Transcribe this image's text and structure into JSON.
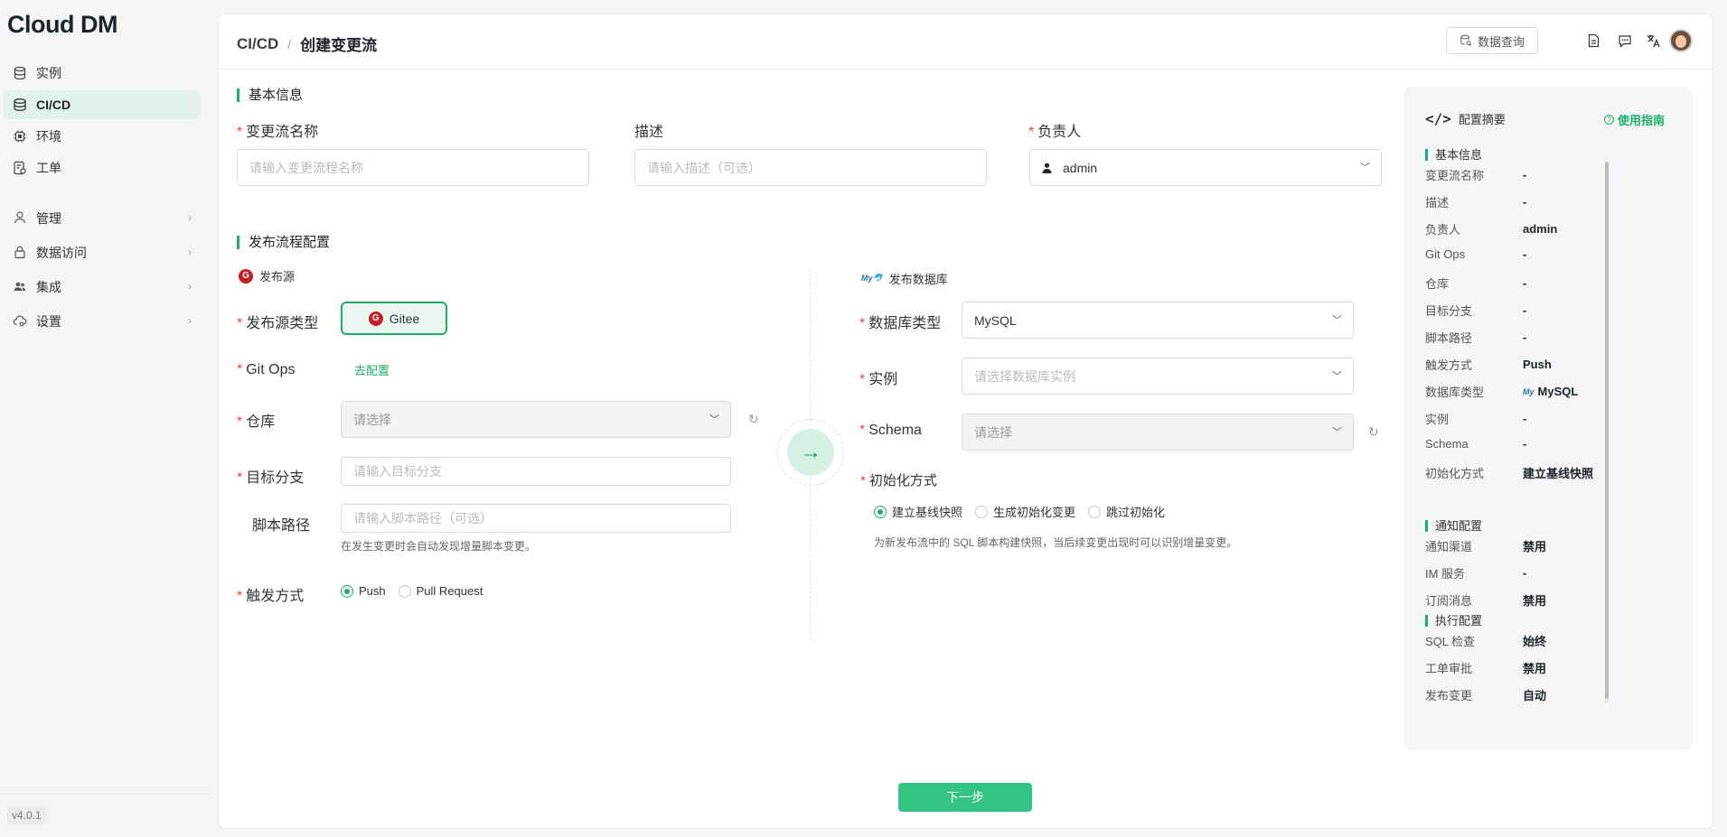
{
  "sidebar": {
    "logo": "Cloud DM",
    "items": [
      {
        "label": "实例",
        "icon": "database-icon"
      },
      {
        "label": "CI/CD",
        "icon": "stack-icon",
        "active": true
      },
      {
        "label": "环境",
        "icon": "chip-icon"
      },
      {
        "label": "工单",
        "icon": "ticket-icon"
      }
    ],
    "groups": [
      {
        "label": "管理",
        "icon": "user-icon"
      },
      {
        "label": "数据访问",
        "icon": "lock-icon"
      },
      {
        "label": "集成",
        "icon": "people-icon"
      },
      {
        "label": "设置",
        "icon": "cloud-gear-icon"
      }
    ],
    "version": "v4.0.1"
  },
  "header": {
    "breadcrumb_root": "CI/CD",
    "breadcrumb_sep": "/",
    "breadcrumb_current": "创建变更流",
    "query_button": "数据查询"
  },
  "basic": {
    "title": "基本信息",
    "name_label": "变更流名称",
    "name_placeholder": "请输入变更流程名称",
    "desc_label": "描述",
    "desc_placeholder": "请输入描述（可选）",
    "owner_label": "负责人",
    "owner_value": "admin"
  },
  "flow": {
    "title": "发布流程配置",
    "source": {
      "title": "发布源",
      "type_label": "发布源类型",
      "type_value": "Gitee",
      "gitops_label": "Git Ops",
      "gitops_link": "去配置",
      "repo_label": "仓库",
      "repo_placeholder": "请选择",
      "branch_label": "目标分支",
      "branch_placeholder": "请输入目标分支",
      "path_label": "脚本路径",
      "path_placeholder": "请输入脚本路径（可选）",
      "path_hint": "在发生变更时会自动发现增量脚本变更。",
      "trigger_label": "触发方式",
      "trigger_options": [
        "Push",
        "Pull Request"
      ],
      "trigger_selected": "Push"
    },
    "target": {
      "title": "发布数据库",
      "dbtype_label": "数据库类型",
      "dbtype_value": "MySQL",
      "instance_label": "实例",
      "instance_placeholder": "请选择数据库实例",
      "schema_label": "Schema",
      "schema_placeholder": "请选择",
      "init_label": "初始化方式",
      "init_options": [
        "建立基线快照",
        "生成初始化变更",
        "跳过初始化"
      ],
      "init_selected": "建立基线快照",
      "init_hint": "为新发布流中的 SQL 脚本构建快照，当后续变更出现时可以识别增量变更。"
    }
  },
  "next_button": "下一步",
  "summary": {
    "title": "配置摘要",
    "guide": "使用指南",
    "basic_title": "基本信息",
    "basic_rows": [
      {
        "k": "变更流名称",
        "v": "-"
      },
      {
        "k": "描述",
        "v": "-"
      },
      {
        "k": "负责人",
        "v": "admin"
      },
      {
        "k": "Git Ops",
        "v": "-"
      },
      {
        "k": "仓库",
        "v": "-"
      },
      {
        "k": "目标分支",
        "v": "-"
      },
      {
        "k": "脚本路径",
        "v": "-"
      },
      {
        "k": "触发方式",
        "v": "Push"
      },
      {
        "k": "数据库类型",
        "v": "MySQL"
      },
      {
        "k": "实例",
        "v": "-"
      },
      {
        "k": "Schema",
        "v": "-"
      },
      {
        "k": "初始化方式",
        "v": "建立基线快照"
      }
    ],
    "notify_title": "通知配置",
    "notify_rows": [
      {
        "k": "通知渠道",
        "v": "禁用"
      },
      {
        "k": "IM 服务",
        "v": "-"
      },
      {
        "k": "订阅消息",
        "v": "禁用"
      }
    ],
    "exec_title": "执行配置",
    "exec_rows": [
      {
        "k": "SQL 检查",
        "v": "始终"
      },
      {
        "k": "工单审批",
        "v": "禁用"
      },
      {
        "k": "发布变更",
        "v": "自动"
      }
    ]
  },
  "colors": {
    "accent": "#1fae6a",
    "required": "#e5484d",
    "button": "#33c482"
  }
}
